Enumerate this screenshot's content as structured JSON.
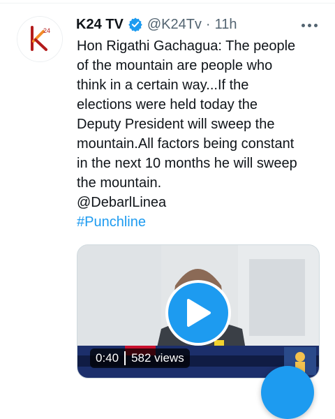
{
  "tweet": {
    "display_name": "K24 TV",
    "handle": "@K24Tv",
    "separator": "·",
    "time": "11h",
    "verified_icon": "verified-badge-icon",
    "more_icon": "more-horizontal-icon",
    "avatar_icon": "k24-logo-icon",
    "text": "Hon Rigathi Gachagua: The people\nof the mountain are people who\nthink in a certain way...If the\nelections were held today the\nDeputy President will sweep the\nmountain.All factors being constant\nin the next 10 months he will sweep\nthe mountain.",
    "mention": "@DebarlLinea",
    "hashtag": "#Punchline"
  },
  "media": {
    "type": "video",
    "duration": "0:40",
    "views": "582 views",
    "play_icon": "play-icon"
  },
  "fab": {
    "icon": "compose-icon"
  },
  "colors": {
    "accent": "#1d9bf0",
    "text": "#0f1419",
    "muted": "#536471",
    "border": "#cfd9de"
  }
}
